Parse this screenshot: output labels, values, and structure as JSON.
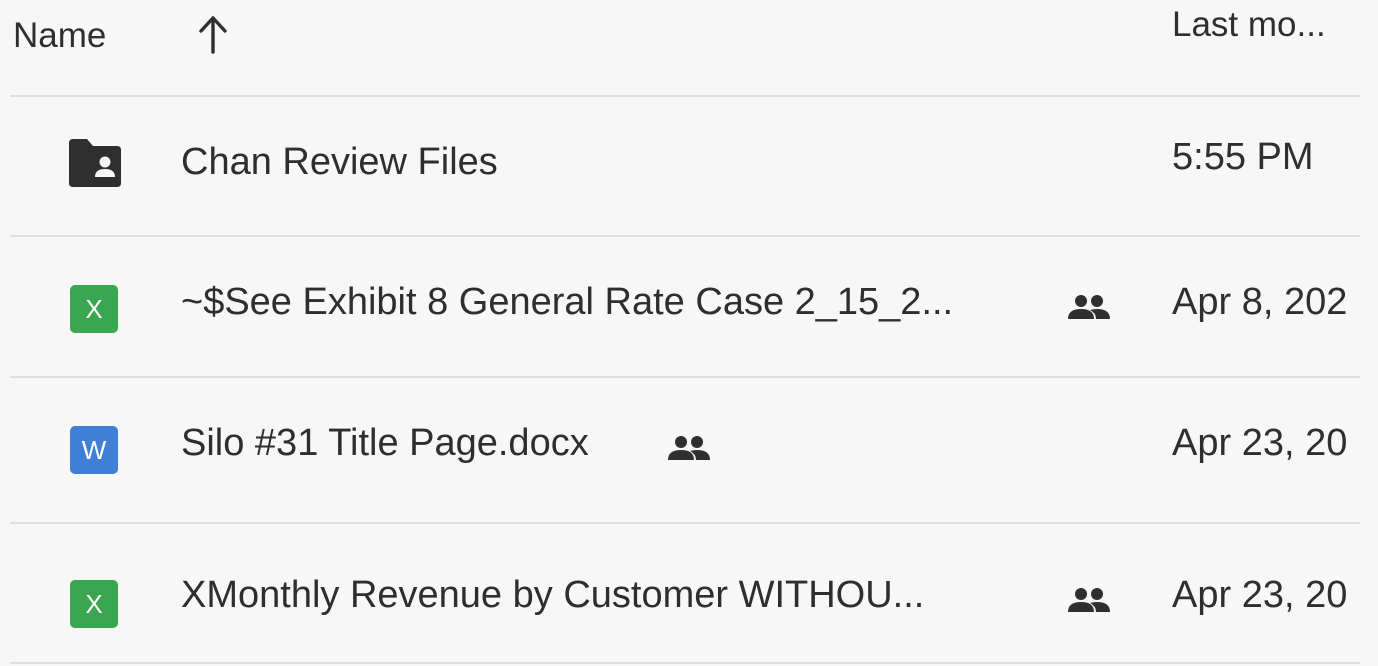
{
  "header": {
    "name_label": "Name",
    "sort_icon": "arrow-up-icon",
    "modified_label": "Last mo..."
  },
  "rows": [
    {
      "icon": "shared-folder-icon",
      "name": "Chan Review Files",
      "shared": false,
      "modified": "5:55 PM"
    },
    {
      "icon": "excel-file-icon",
      "icon_text": "X",
      "name": "~$See Exhibit 8 General Rate Case 2_15_2...",
      "shared": true,
      "modified": "Apr 8, 202"
    },
    {
      "icon": "word-file-icon",
      "icon_text": "W",
      "name": "Silo #31 Title Page.docx",
      "shared": true,
      "modified": "Apr 23, 20"
    },
    {
      "icon": "excel-file-icon",
      "icon_text": "X",
      "name": "XMonthly Revenue by Customer WITHOU...",
      "shared": true,
      "modified": "Apr 23, 20"
    }
  ],
  "colors": {
    "excel_green": "#3aa650",
    "word_blue": "#3f7fd6",
    "folder_dark": "#2f2f2f",
    "divider": "#dedede"
  }
}
